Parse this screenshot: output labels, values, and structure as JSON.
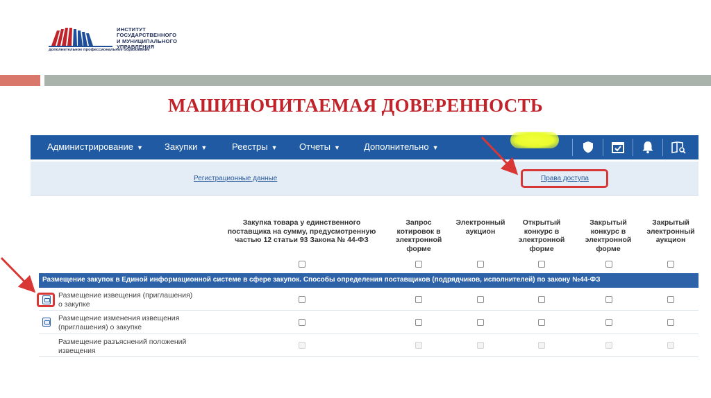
{
  "logo": {
    "org_lines": [
      "ИНСТИТУТ",
      "ГОСУДАРСТВЕННОГО",
      "И МУНИЦИПАЛЬНОГО",
      "УПРАВЛЕНИЯ"
    ],
    "tagline": "дополнительное профессиональное образование"
  },
  "slide_title": "МАШИНОЧИТАЕМАЯ ДОВЕРЕННОСТЬ",
  "nav": {
    "items": [
      {
        "label": "Администрирование"
      },
      {
        "label": "Закупки"
      },
      {
        "label": "Реестры"
      },
      {
        "label": "Отчеты"
      },
      {
        "label": "Дополнительно"
      }
    ],
    "icons": [
      "shield-icon",
      "calendar-check-icon",
      "bell-icon",
      "book-search-icon"
    ]
  },
  "subnav": {
    "registration": "Регистрационные данные",
    "access_rights": "Права доступа"
  },
  "table": {
    "columns": [
      {
        "label": "Закупка товара у единственного поставщика на сумму, предусмотренную частью 12 статьи 93 Закона № 44-ФЗ"
      },
      {
        "label": "Запрос котировок в электронной форме"
      },
      {
        "label": "Электронный аукцион"
      },
      {
        "label": "Открытый конкурс в электронной форме"
      },
      {
        "label": "Закрытый конкурс в электронной форме"
      },
      {
        "label": "Закрытый электронный аукцион"
      }
    ],
    "section_title": "Размещение закупок в Единой информационной системе в сфере закупок. Способы определения поставщиков (подрядчиков, исполнителей) по закону №44-ФЗ",
    "rows": [
      {
        "label": "Размещение извещения (приглашения) о закупке"
      },
      {
        "label": "Размещение изменения извещения (приглашения) о закупке"
      },
      {
        "label": "Размещение разъяснений положений извещения"
      }
    ]
  },
  "colors": {
    "accent_red": "#c0242a",
    "nav_blue": "#1f5aa3",
    "section_blue": "#2e63aa",
    "highlight_yellow": "#e9fb2c"
  }
}
